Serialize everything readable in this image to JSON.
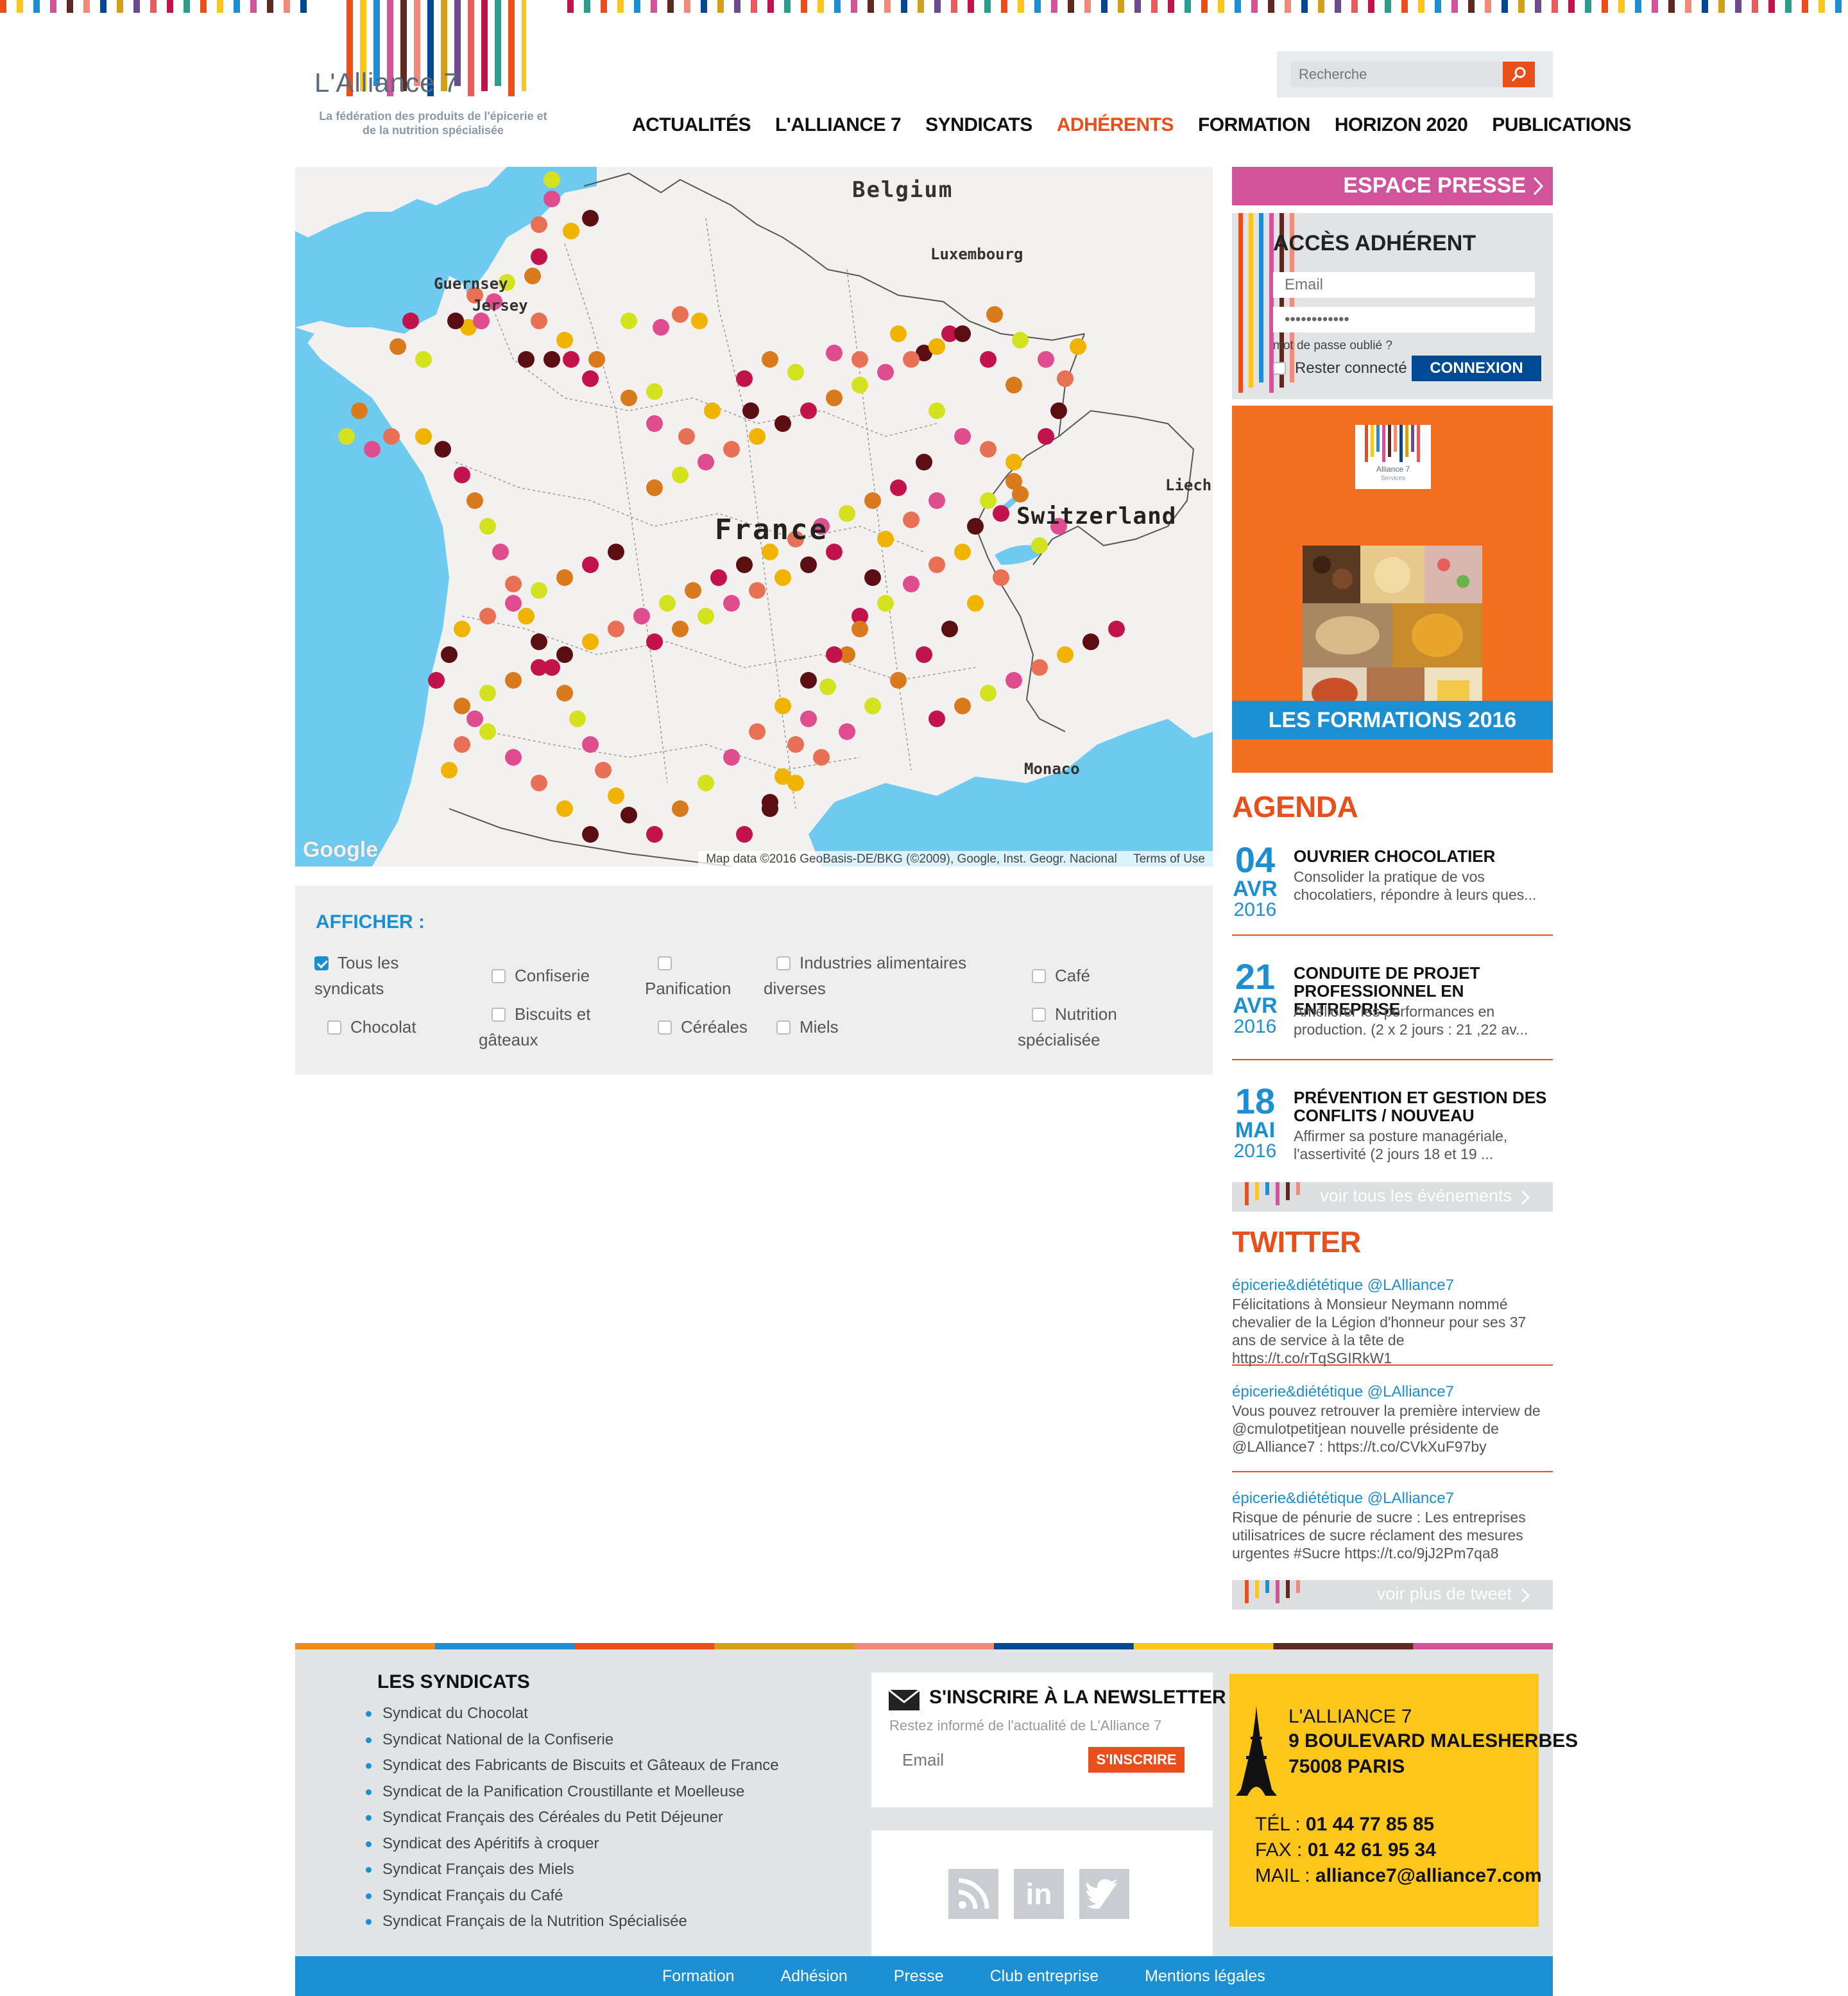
{
  "header": {
    "logo_word": "L'Alliance 7",
    "logo_tagline": "La fédération des produits de l'épicerie et de la nutrition spécialisée",
    "search_placeholder": "Recherche"
  },
  "nav": {
    "items": [
      "ACTUALITÉS",
      "L'ALLIANCE 7",
      "SYNDICATS",
      "ADHÉRENTS",
      "FORMATION",
      "HORIZON 2020",
      "PUBLICATIONS"
    ],
    "active": "ADHÉRENTS"
  },
  "map": {
    "labels": {
      "belgium": "Belgium",
      "luxembourg": "Luxembourg",
      "guernsey": "Guernsey",
      "jersey": "Jersey",
      "france": "France",
      "switzerland": "Switzerland",
      "liech": "Liech",
      "monaco": "Monaco"
    },
    "attribution": "Map data ©2016 GeoBasis-DE/BKG (©2009), Google, Inst. Geogr. Nacional",
    "terms": "Terms of Use",
    "google": "Google",
    "marker_colors": [
      "#c3134d",
      "#e04d8e",
      "#5c0f12",
      "#d4e21f",
      "#f0b400",
      "#d97a1c",
      "#e87155"
    ]
  },
  "filter": {
    "title": "AFFICHER :",
    "options": {
      "tous_a": "Tous les",
      "tous_b": "syndicats",
      "confiserie": "Confiserie",
      "panification": "Panification",
      "industries_a": "Industries alimentaires",
      "industries_b": "diverses",
      "cafe": "Café",
      "chocolat": "Chocolat",
      "biscuits_a": "Biscuits et",
      "biscuits_b": "gâteaux",
      "cereales": "Céréales",
      "miels": "Miels",
      "nutrition_a": "Nutrition",
      "nutrition_b": "spécialisée"
    }
  },
  "sidebar": {
    "espace_presse": "ESPACE PRESSE",
    "acces": {
      "title": "ACCÈS ADHÉRENT",
      "email_placeholder": "Email",
      "password_value": "••••••••••••",
      "forgot": "mot de passe oublié ?",
      "remember": "Rester connecté",
      "submit": "CONNEXION"
    },
    "formations": {
      "logo_text": "Alliance 7",
      "logo_sub": "Services",
      "label": "LES FORMATIONS 2016"
    },
    "agenda_title": "AGENDA",
    "events": [
      {
        "day": "04",
        "month": "AVR",
        "year": "2016",
        "title": "OUVRIER CHOCOLATIER",
        "desc": "Consolider la pratique de vos chocolatiers, répondre à leurs ques..."
      },
      {
        "day": "21",
        "month": "AVR",
        "year": "2016",
        "title": "CONDUITE DE PROJET PROFESSIONNEL EN ENTREPRISE",
        "desc": "Améliorer les performances en production. (2 x 2 jours : 21 ,22 av..."
      },
      {
        "day": "18",
        "month": "MAI",
        "year": "2016",
        "title": "PRÉVENTION ET GESTION DES CONFLITS / NOUVEAU",
        "desc": "Affirmer sa posture managériale, l'assertivité (2 jours 18 et 19 ..."
      }
    ],
    "all_events": "voir tous les événements",
    "twitter_title": "TWITTER",
    "tweets": [
      {
        "handle": "épicerie&diététique @LAlliance7",
        "text": "Félicitations à Monsieur Neymann nommé chevalier de la Légion d'honneur pour ses 37 ans de service à la tête de https://t.co/rTqSGIRkW1"
      },
      {
        "handle": "épicerie&diététique @LAlliance7",
        "text": "Vous pouvez retrouver la première interview de @cmulotpetitjean nouvelle présidente de @LAlliance7 : https://t.co/CVkXuF97by"
      },
      {
        "handle": "épicerie&diététique @LAlliance7",
        "text": "Risque de pénurie de sucre : Les entreprises utilisatrices de sucre réclament des mesures urgentes #Sucre https://t.co/9jJ2Pm7qa8"
      }
    ],
    "more_tweets": "voir plus de tweet"
  },
  "footer": {
    "syndicats_title": "LES SYNDICATS",
    "syndicats": [
      "Syndicat du Chocolat",
      "Syndicat National de la Confiserie",
      "Syndicat des Fabricants de Biscuits et Gâteaux de France",
      "Syndicat de la Panification Croustillante et Moelleuse",
      "Syndicat Français des Céréales du Petit Déjeuner",
      "Syndicat des Apéritifs à croquer",
      "Syndicat Français des Miels",
      "Syndicat Français du Café",
      "Syndicat Français de la Nutrition Spécialisée"
    ],
    "newsletter": {
      "title": "S'INSCRIRE À LA NEWSLETTER",
      "subtitle": "Restez informé de l'actualité de L'Alliance 7",
      "placeholder": "Email",
      "button": "S'INSCRIRE"
    },
    "social": [
      "rss-icon",
      "linkedin-icon",
      "twitter-icon"
    ],
    "contact": {
      "name": "L'ALLIANCE 7",
      "street": "9 BOULEVARD MALESHERBES",
      "city": "75008 PARIS",
      "tel_label": "TÉL : ",
      "tel": "01 44 77 85 85",
      "fax_label": "FAX : ",
      "fax": "01 42 61 95 34",
      "mail_label": "MAIL : ",
      "mail": "alliance7@alliance7.com"
    },
    "bottom_links": [
      "Formation",
      "Adhésion",
      "Presse",
      "Club entreprise",
      "Mentions légales"
    ]
  }
}
